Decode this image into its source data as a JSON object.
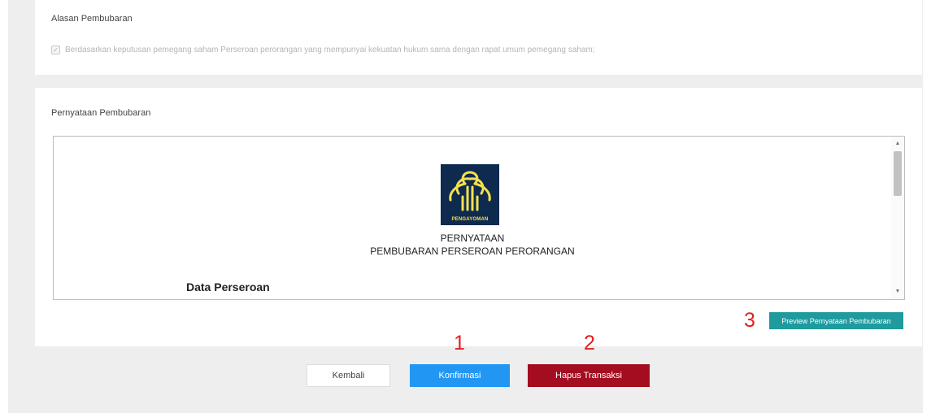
{
  "reason_section": {
    "title": "Alasan Pembubaran",
    "checkbox_label": "Berdasarkan keputusan pemegang saham Perseroan perorangan yang mempunyai kekuatan hukum sama dengan rapat umum pemegang saham;",
    "checked": true
  },
  "statement_section": {
    "title": "Pernyataan Pembubaran",
    "document": {
      "logo_text": "PENGAYOMAN",
      "heading_line1": "PERNYATAAN",
      "heading_line2": "PEMBUBARAN PERSEROAN PERORANGAN",
      "section_heading": "Data Perseroan"
    },
    "preview_button": "Preview Pernyataan Pembubaran"
  },
  "actions": {
    "back_label": "Kembali",
    "confirm_label": "Konfirmasi",
    "delete_label": "Hapus Transaksi"
  },
  "annotations": {
    "marker_1": "1",
    "marker_2": "2",
    "marker_3": "3"
  },
  "icons": {
    "checkbox": "check-icon",
    "scroll_up": "triangle-up-icon",
    "scroll_down": "triangle-down-icon",
    "logo": "pengayoman-tree-icon"
  },
  "colors": {
    "confirm": "#2196f3",
    "delete": "#a30d1f",
    "preview": "#1f9a9d",
    "annotation": "#e41e1e",
    "logo_bg": "#0e2a4f",
    "logo_fg": "#f4e04d"
  }
}
